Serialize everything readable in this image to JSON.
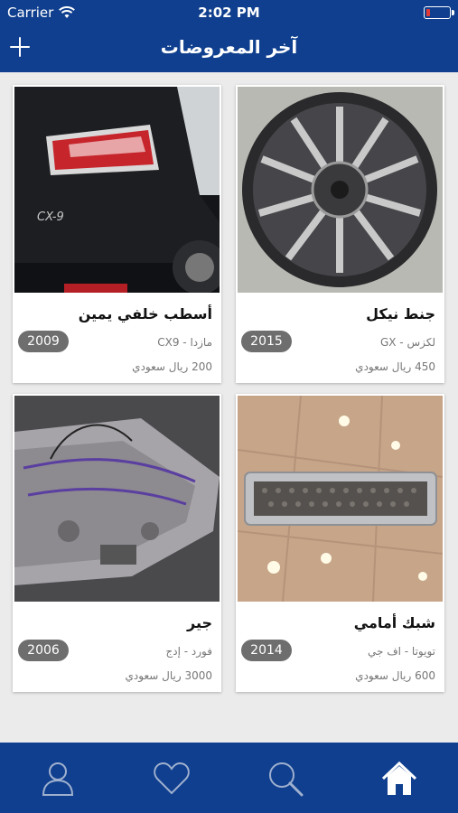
{
  "status_bar": {
    "carrier": "Carrier",
    "time": "2:02 PM"
  },
  "header": {
    "title": "آخر المعروضات",
    "add_icon": "plus-icon"
  },
  "listings": [
    {
      "name": "جنط نيكل",
      "model": "لكزس - GX",
      "price": "450 ريال سعودي",
      "year": "2015",
      "image": "alloy-wheel-photo"
    },
    {
      "name": "أسطب خلفي يمين",
      "model": "مازدا - CX9",
      "price": "200 ريال سعودي",
      "year": "2009",
      "image": "car-tail-light-photo"
    },
    {
      "name": "شبك أمامي",
      "model": "تويوتا - اف جي",
      "price": "600 ريال سعودي",
      "year": "2014",
      "image": "front-grille-photo"
    },
    {
      "name": "جير",
      "model": "فورد - إدج",
      "price": "3000 ريال سعودي",
      "year": "2006",
      "image": "transmission-photo"
    }
  ],
  "tab_bar": {
    "items": [
      {
        "icon": "home-icon",
        "active": true
      },
      {
        "icon": "search-icon",
        "active": false
      },
      {
        "icon": "heart-icon",
        "active": false
      },
      {
        "icon": "user-icon",
        "active": false
      }
    ]
  },
  "colors": {
    "brand": "#0f3f8e",
    "year_badge": "#6e6e6e",
    "background": "#ebebeb"
  }
}
